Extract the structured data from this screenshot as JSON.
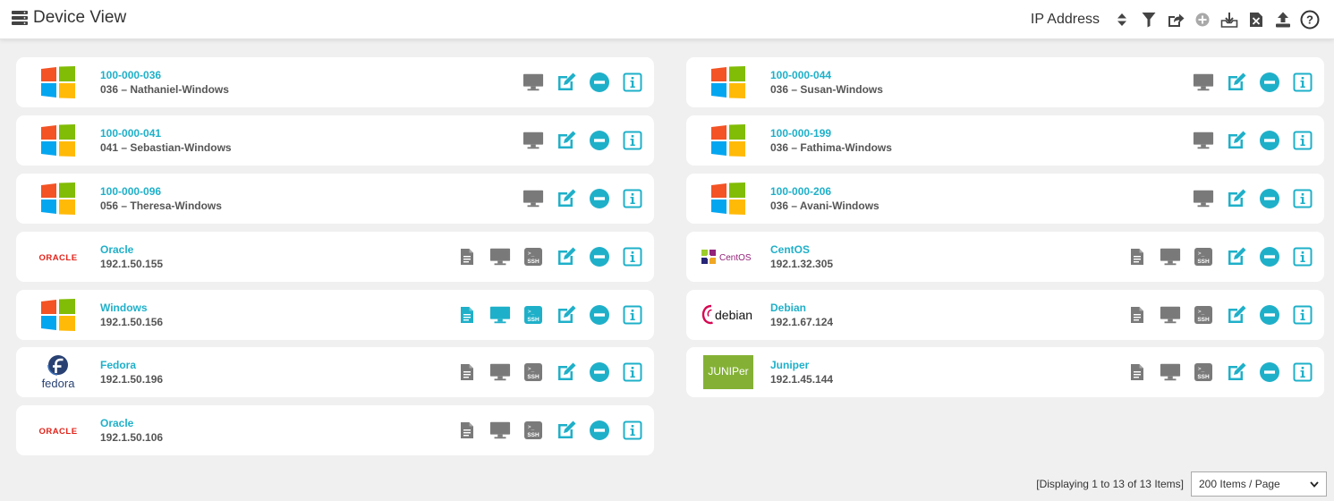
{
  "header": {
    "title": "Device View",
    "sort_label": "IP Address",
    "toolbar_icons": [
      "sort-icon",
      "filter-icon",
      "share-icon",
      "add-icon",
      "import-icon",
      "excel-export-icon",
      "upload-icon",
      "help-icon"
    ]
  },
  "colors": {
    "accent": "#1fb0c9",
    "icon_gray": "#7a7a7a",
    "active": "#1fb0c9"
  },
  "devices": [
    {
      "name": "100-000-036",
      "sub": "036 – Nathaniel-Windows",
      "os": "windows",
      "actions": [
        "monitor",
        "edit",
        "remove",
        "info"
      ]
    },
    {
      "name": "100-000-044",
      "sub": "036 – Susan-Windows",
      "os": "windows",
      "actions": [
        "monitor",
        "edit",
        "remove",
        "info"
      ]
    },
    {
      "name": "100-000-041",
      "sub": "041 – Sebastian-Windows",
      "os": "windows",
      "actions": [
        "monitor",
        "edit",
        "remove",
        "info"
      ]
    },
    {
      "name": "100-000-199",
      "sub": "036 – Fathima-Windows",
      "os": "windows",
      "actions": [
        "monitor",
        "edit",
        "remove",
        "info"
      ]
    },
    {
      "name": "100-000-096",
      "sub": "056 – Theresa-Windows",
      "os": "windows",
      "actions": [
        "monitor",
        "edit",
        "remove",
        "info"
      ]
    },
    {
      "name": "100-000-206",
      "sub": "036 – Avani-Windows",
      "os": "windows",
      "actions": [
        "monitor",
        "edit",
        "remove",
        "info"
      ]
    },
    {
      "name": "Oracle",
      "sub": "192.1.50.155",
      "os": "oracle",
      "logo_text": "ORACLE",
      "actions": [
        "file",
        "monitor",
        "ssh",
        "edit",
        "remove",
        "info"
      ]
    },
    {
      "name": "CentOS",
      "sub": "192.1.32.305",
      "os": "centos",
      "logo_text": "CentOS",
      "actions": [
        "file",
        "monitor",
        "ssh",
        "edit",
        "remove",
        "info"
      ]
    },
    {
      "name": "Windows",
      "sub": "192.1.50.156",
      "os": "windows",
      "active": true,
      "actions": [
        "file",
        "monitor",
        "ssh",
        "edit",
        "remove",
        "info"
      ]
    },
    {
      "name": "Debian",
      "sub": "192.1.67.124",
      "os": "debian",
      "logo_text": "debian",
      "actions": [
        "file",
        "monitor",
        "ssh",
        "edit",
        "remove",
        "info"
      ]
    },
    {
      "name": "Fedora",
      "sub": "192.1.50.196",
      "os": "fedora",
      "logo_text": "fedora",
      "actions": [
        "file",
        "monitor",
        "ssh",
        "edit",
        "remove",
        "info"
      ]
    },
    {
      "name": "Juniper",
      "sub": "192.1.45.144",
      "os": "juniper",
      "logo_text": "JUNIPer",
      "actions": [
        "file",
        "monitor",
        "ssh",
        "edit",
        "remove",
        "info"
      ]
    },
    {
      "name": "Oracle",
      "sub": "192.1.50.106",
      "os": "oracle",
      "logo_text": "ORACLE",
      "actions": [
        "file",
        "monitor",
        "ssh",
        "edit",
        "remove",
        "info"
      ]
    }
  ],
  "footer": {
    "count_text": "[Displaying 1 to 13 of 13 Items]",
    "per_page": "200 Items / Page"
  }
}
